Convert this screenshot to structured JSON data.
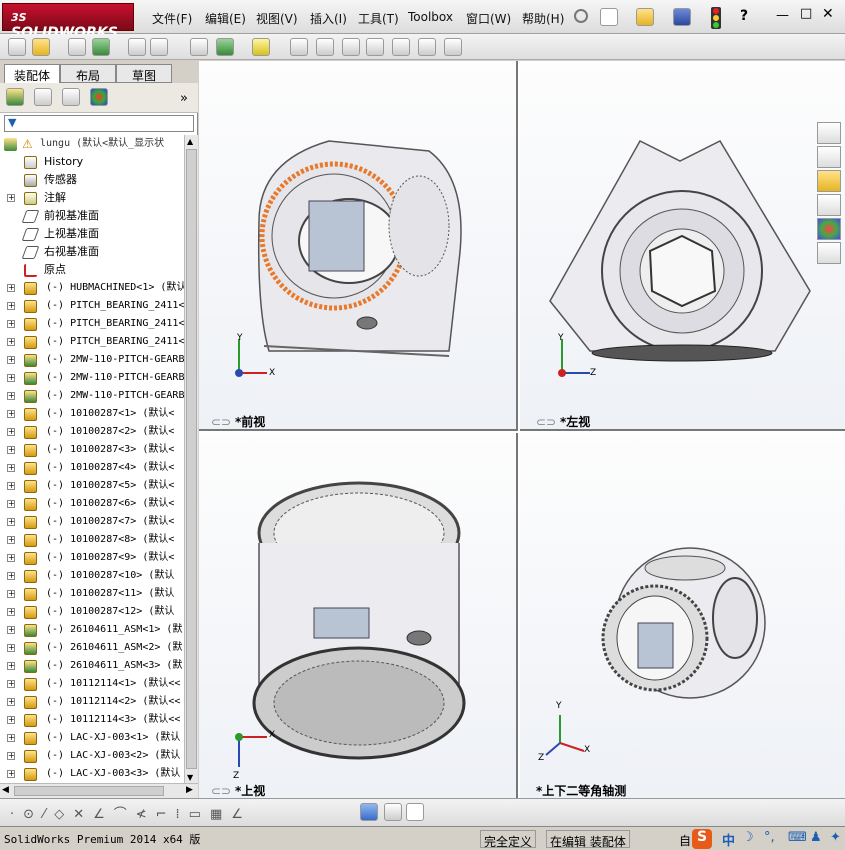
{
  "app": {
    "logo": "SOLIDWORKS",
    "logo_prefix": "3S"
  },
  "menu": [
    "文件(F)",
    "编辑(E)",
    "视图(V)",
    "插入(I)",
    "工具(T)",
    "Toolbox",
    "窗口(W)",
    "帮助(H)"
  ],
  "panel_tabs": [
    "装配体",
    "布局",
    "草图"
  ],
  "tree": {
    "root": "lungu  (默认<默认_显示状",
    "items": [
      {
        "label": "History",
        "icon": "history-icon",
        "expand": false
      },
      {
        "label": "传感器",
        "icon": "sensor-icon",
        "expand": false
      },
      {
        "label": "注解",
        "icon": "annotation-icon",
        "expand": true
      },
      {
        "label": "前视基准面",
        "icon": "plane-icon",
        "expand": false
      },
      {
        "label": "上视基准面",
        "icon": "plane-icon",
        "expand": false
      },
      {
        "label": "右视基准面",
        "icon": "plane-icon",
        "expand": false
      },
      {
        "label": "原点",
        "icon": "origin-icon",
        "expand": false
      },
      {
        "label": "(-) HUBMACHINED<1> (默认",
        "icon": "part-icon",
        "expand": true
      },
      {
        "label": "(-) PITCH_BEARING_2411<",
        "icon": "part-icon",
        "expand": true
      },
      {
        "label": "(-) PITCH_BEARING_2411<",
        "icon": "part-icon",
        "expand": true
      },
      {
        "label": "(-) PITCH_BEARING_2411<",
        "icon": "part-icon",
        "expand": true
      },
      {
        "label": "(-) 2MW-110-PITCH-GEARB",
        "icon": "assembly-icon",
        "expand": true
      },
      {
        "label": "(-) 2MW-110-PITCH-GEARB",
        "icon": "assembly-icon",
        "expand": true
      },
      {
        "label": "(-) 2MW-110-PITCH-GEARB",
        "icon": "assembly-icon",
        "expand": true
      },
      {
        "label": "(-) 10100287<1> (默认<",
        "icon": "part-icon",
        "expand": true
      },
      {
        "label": "(-) 10100287<2> (默认<",
        "icon": "part-icon",
        "expand": true
      },
      {
        "label": "(-) 10100287<3> (默认<",
        "icon": "part-icon",
        "expand": true
      },
      {
        "label": "(-) 10100287<4> (默认<",
        "icon": "part-icon",
        "expand": true
      },
      {
        "label": "(-) 10100287<5> (默认<",
        "icon": "part-icon",
        "expand": true
      },
      {
        "label": "(-) 10100287<6> (默认<",
        "icon": "part-icon",
        "expand": true
      },
      {
        "label": "(-) 10100287<7> (默认<",
        "icon": "part-icon",
        "expand": true
      },
      {
        "label": "(-) 10100287<8> (默认<",
        "icon": "part-icon",
        "expand": true
      },
      {
        "label": "(-) 10100287<9> (默认<",
        "icon": "part-icon",
        "expand": true
      },
      {
        "label": "(-) 10100287<10> (默认",
        "icon": "part-icon",
        "expand": true
      },
      {
        "label": "(-) 10100287<11> (默认",
        "icon": "part-icon",
        "expand": true
      },
      {
        "label": "(-) 10100287<12> (默认",
        "icon": "part-icon",
        "expand": true
      },
      {
        "label": "(-) 26104611_ASM<1> (默",
        "icon": "assembly-icon",
        "expand": true
      },
      {
        "label": "(-) 26104611_ASM<2> (默",
        "icon": "assembly-icon",
        "expand": true
      },
      {
        "label": "(-) 26104611_ASM<3> (默",
        "icon": "assembly-icon",
        "expand": true
      },
      {
        "label": "(-) 10112114<1> (默认<<",
        "icon": "part-icon",
        "expand": true
      },
      {
        "label": "(-) 10112114<2> (默认<<",
        "icon": "part-icon",
        "expand": true
      },
      {
        "label": "(-) 10112114<3> (默认<<",
        "icon": "part-icon",
        "expand": true
      },
      {
        "label": "(-) LAC-XJ-003<1> (默认",
        "icon": "part-icon",
        "expand": true
      },
      {
        "label": "(-) LAC-XJ-003<2> (默认",
        "icon": "part-icon",
        "expand": true
      },
      {
        "label": "(-) LAC-XJ-003<3> (默认",
        "icon": "part-icon",
        "expand": true
      }
    ]
  },
  "viewports": {
    "front": "*前视",
    "left": "*左视",
    "top": "*上视",
    "dimetric": "*上下二等角轴测"
  },
  "axes": {
    "x": "X",
    "y": "Y",
    "z": "Z"
  },
  "status": {
    "version": "SolidWorks Premium 2014 x64 版",
    "defined": "完全定义",
    "editing": "在编辑 装配体",
    "custom": "自"
  },
  "ime": {
    "lang": "中"
  },
  "colors": {
    "accent": "#c8102e",
    "bearing_highlight": "#e8782a"
  }
}
